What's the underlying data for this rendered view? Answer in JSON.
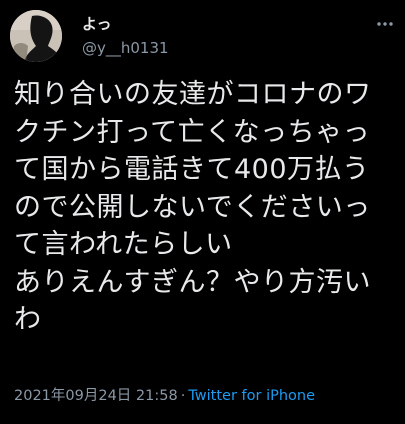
{
  "tweet": {
    "author": {
      "display_name": "よっ",
      "handle": "@y__h0131",
      "avatar": "profile-avatar"
    },
    "more_icon": "more-options-icon",
    "text_lines": [
      "知り合いの友達がコロナのワ",
      "クチン打って亡くなっちゃっ",
      "て国から電話きて400万払う",
      "ので公開しないでくださいっ",
      "て言われたらしい",
      "ありえんすぎん？やり方汚い",
      "わ"
    ],
    "timestamp": "2021年09月24日 21:58",
    "separator": "·",
    "source": "Twitter for iPhone"
  },
  "colors": {
    "background": "#000000",
    "text_primary": "#e7e9ea",
    "text_secondary": "#8b98a5",
    "link": "#1d9bf0"
  }
}
